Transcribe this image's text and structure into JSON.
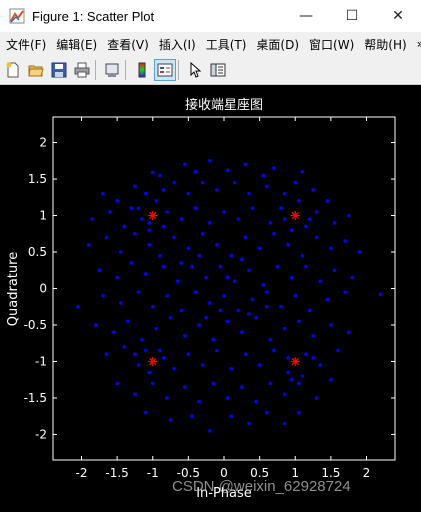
{
  "window": {
    "title": "Figure 1: Scatter Plot",
    "minimize_glyph": "—",
    "maximize_glyph": "☐",
    "close_glyph": "✕"
  },
  "menu": [
    "文件(F)",
    "编辑(E)",
    "查看(V)",
    "插入(I)",
    "工具(T)",
    "桌面(D)",
    "窗口(W)",
    "帮助(H)"
  ],
  "menu_overflow_glyph": "»",
  "toolbar": {
    "icons": [
      "new-figure-icon",
      "open-file-icon",
      "save-icon",
      "print-icon",
      "link-icon",
      "colorbar-icon",
      "legend-icon",
      "pointer-icon",
      "property-editor-icon"
    ]
  },
  "colors": {
    "received_points": "#0000ff",
    "constellation_points": "#ff0000",
    "axes_bg": "#000000",
    "axes_fg": "#ffffff"
  },
  "chart_data": {
    "type": "scatter",
    "title": "接收端星座图",
    "xlabel": "In-Phase",
    "ylabel": "Quadrature",
    "xlim": [
      -2.4,
      2.4
    ],
    "ylim": [
      -2.35,
      2.35
    ],
    "x_ticks": [
      -2,
      -1.5,
      -1,
      -0.5,
      0,
      0.5,
      1,
      1.5,
      2
    ],
    "y_ticks": [
      -2,
      -1.5,
      -1,
      -0.5,
      0,
      0.5,
      1,
      1.5,
      2
    ],
    "x_tick_labels": [
      "-2",
      "-1.5",
      "-1",
      "-0.5",
      "0",
      "0.5",
      "1",
      "1.5",
      "2"
    ],
    "y_tick_labels": [
      "-2",
      "-1.5",
      "-1",
      "-0.5",
      "0",
      "0.5",
      "1",
      "1.5",
      "2"
    ],
    "grid": false,
    "series": [
      {
        "marker": "dot",
        "color": "#0000ff",
        "points": [
          [
            -1.0,
            1.59
          ],
          [
            -0.9,
            1.55
          ],
          [
            -0.55,
            1.7
          ],
          [
            -0.4,
            1.6
          ],
          [
            -0.2,
            1.75
          ],
          [
            0.05,
            1.62
          ],
          [
            0.3,
            1.7
          ],
          [
            0.55,
            1.55
          ],
          [
            0.7,
            1.65
          ],
          [
            1.1,
            1.6
          ],
          [
            -1.7,
            1.3
          ],
          [
            -1.5,
            1.2
          ],
          [
            -1.25,
            1.4
          ],
          [
            -1.1,
            1.3
          ],
          [
            -0.85,
            1.35
          ],
          [
            -0.7,
            1.45
          ],
          [
            -0.5,
            1.3
          ],
          [
            -0.3,
            1.45
          ],
          [
            -0.1,
            1.35
          ],
          [
            0.15,
            1.45
          ],
          [
            0.35,
            1.3
          ],
          [
            0.6,
            1.4
          ],
          [
            0.85,
            1.3
          ],
          [
            1.0,
            1.45
          ],
          [
            1.25,
            1.35
          ],
          [
            1.45,
            1.2
          ],
          [
            -1.85,
            0.95
          ],
          [
            -1.6,
            1.05
          ],
          [
            -1.4,
            0.85
          ],
          [
            -1.2,
            1.1
          ],
          [
            -1.05,
            0.9
          ],
          [
            -0.8,
            1.05
          ],
          [
            -0.6,
            0.95
          ],
          [
            -0.4,
            1.1
          ],
          [
            -0.2,
            0.9
          ],
          [
            0.0,
            1.05
          ],
          [
            0.2,
            0.95
          ],
          [
            0.4,
            1.1
          ],
          [
            0.65,
            0.9
          ],
          [
            0.8,
            1.1
          ],
          [
            1.15,
            0.85
          ],
          [
            1.3,
            1.05
          ],
          [
            1.55,
            0.9
          ],
          [
            1.75,
            1.0
          ],
          [
            -1.9,
            0.6
          ],
          [
            -1.65,
            0.7
          ],
          [
            -1.45,
            0.5
          ],
          [
            -1.25,
            0.75
          ],
          [
            -1.05,
            0.6
          ],
          [
            -0.9,
            0.45
          ],
          [
            -0.7,
            0.7
          ],
          [
            -0.5,
            0.55
          ],
          [
            -0.3,
            0.75
          ],
          [
            -0.1,
            0.6
          ],
          [
            0.1,
            0.45
          ],
          [
            0.3,
            0.7
          ],
          [
            0.5,
            0.55
          ],
          [
            0.7,
            0.75
          ],
          [
            0.9,
            0.6
          ],
          [
            1.1,
            0.45
          ],
          [
            1.3,
            0.7
          ],
          [
            1.5,
            0.55
          ],
          [
            1.7,
            0.65
          ],
          [
            1.9,
            0.5
          ],
          [
            -1.75,
            0.25
          ],
          [
            -1.5,
            0.15
          ],
          [
            -1.3,
            0.35
          ],
          [
            -1.1,
            0.2
          ],
          [
            -0.85,
            0.3
          ],
          [
            -0.65,
            0.1
          ],
          [
            -0.45,
            0.3
          ],
          [
            -0.25,
            0.15
          ],
          [
            -0.05,
            0.3
          ],
          [
            0.15,
            0.1
          ],
          [
            0.35,
            0.25
          ],
          [
            0.55,
            0.05
          ],
          [
            0.75,
            0.3
          ],
          [
            0.95,
            0.15
          ],
          [
            1.15,
            0.3
          ],
          [
            1.35,
            0.1
          ],
          [
            1.55,
            0.25
          ],
          [
            1.8,
            0.15
          ],
          [
            -2.05,
            -0.25
          ],
          [
            -1.7,
            -0.1
          ],
          [
            -1.45,
            -0.2
          ],
          [
            -1.2,
            -0.05
          ],
          [
            -1.0,
            -0.25
          ],
          [
            -0.8,
            -0.1
          ],
          [
            -0.6,
            -0.3
          ],
          [
            -0.4,
            -0.05
          ],
          [
            -0.2,
            -0.2
          ],
          [
            0.0,
            -0.1
          ],
          [
            0.2,
            -0.3
          ],
          [
            0.4,
            -0.15
          ],
          [
            0.6,
            -0.05
          ],
          [
            0.8,
            -0.25
          ],
          [
            1.0,
            -0.1
          ],
          [
            1.2,
            -0.3
          ],
          [
            1.45,
            -0.15
          ],
          [
            1.7,
            -0.05
          ],
          [
            2.2,
            -0.08
          ],
          [
            -1.8,
            -0.5
          ],
          [
            -1.55,
            -0.6
          ],
          [
            -1.35,
            -0.45
          ],
          [
            -1.15,
            -0.7
          ],
          [
            -0.95,
            -0.55
          ],
          [
            -0.75,
            -0.4
          ],
          [
            -0.55,
            -0.65
          ],
          [
            -0.35,
            -0.5
          ],
          [
            -0.15,
            -0.7
          ],
          [
            0.05,
            -0.45
          ],
          [
            0.25,
            -0.6
          ],
          [
            0.45,
            -0.4
          ],
          [
            0.65,
            -0.7
          ],
          [
            0.85,
            -0.55
          ],
          [
            1.05,
            -0.45
          ],
          [
            1.25,
            -0.65
          ],
          [
            1.5,
            -0.5
          ],
          [
            1.75,
            -0.6
          ],
          [
            -1.65,
            -0.9
          ],
          [
            -1.4,
            -0.8
          ],
          [
            -1.2,
            -1.05
          ],
          [
            -0.9,
            -0.85
          ],
          [
            -0.7,
            -1.1
          ],
          [
            -0.5,
            -0.9
          ],
          [
            -0.3,
            -1.05
          ],
          [
            -0.1,
            -0.85
          ],
          [
            0.1,
            -1.1
          ],
          [
            0.3,
            -0.9
          ],
          [
            0.5,
            -1.05
          ],
          [
            0.7,
            -0.85
          ],
          [
            0.9,
            -1.15
          ],
          [
            1.15,
            -0.9
          ],
          [
            1.35,
            -1.05
          ],
          [
            1.6,
            -0.85
          ],
          [
            -1.5,
            -1.3
          ],
          [
            -1.25,
            -1.45
          ],
          [
            -1.0,
            -1.3
          ],
          [
            -0.8,
            -1.5
          ],
          [
            -0.55,
            -1.35
          ],
          [
            -0.35,
            -1.55
          ],
          [
            -0.15,
            -1.3
          ],
          [
            0.05,
            -1.5
          ],
          [
            0.25,
            -1.35
          ],
          [
            0.45,
            -1.55
          ],
          [
            0.65,
            -1.3
          ],
          [
            0.85,
            -1.45
          ],
          [
            1.05,
            -1.3
          ],
          [
            1.3,
            -1.5
          ],
          [
            1.5,
            -1.25
          ],
          [
            -1.1,
            -1.7
          ],
          [
            -0.75,
            -1.8
          ],
          [
            -0.45,
            -1.75
          ],
          [
            -0.2,
            -1.95
          ],
          [
            0.1,
            -1.75
          ],
          [
            0.35,
            -1.85
          ],
          [
            0.6,
            -1.7
          ],
          [
            0.85,
            -1.85
          ],
          [
            1.05,
            -1.7
          ],
          [
            -1.3,
            1.1
          ],
          [
            -1.15,
            0.95
          ],
          [
            -0.95,
            1.2
          ],
          [
            -1.05,
            0.8
          ],
          [
            -0.85,
            0.85
          ],
          [
            0.85,
            0.95
          ],
          [
            1.05,
            1.2
          ],
          [
            1.2,
            0.95
          ],
          [
            0.95,
            0.8
          ],
          [
            -1.25,
            -0.9
          ],
          [
            -1.05,
            -1.15
          ],
          [
            -0.85,
            -0.95
          ],
          [
            -1.1,
            -0.85
          ],
          [
            0.9,
            -0.95
          ],
          [
            1.1,
            -1.2
          ],
          [
            1.25,
            -0.95
          ],
          [
            0.95,
            -1.25
          ],
          [
            -0.6,
            0.35
          ],
          [
            -0.35,
            0.45
          ],
          [
            0.35,
            -0.35
          ],
          [
            0.6,
            -0.25
          ],
          [
            0.25,
            0.4
          ],
          [
            -0.25,
            -0.4
          ],
          [
            0.05,
            0.15
          ],
          [
            -0.05,
            -0.3
          ]
        ]
      },
      {
        "marker": "star",
        "color": "#ff0000",
        "points": [
          [
            -1,
            1
          ],
          [
            1,
            1
          ],
          [
            -1,
            -1
          ],
          [
            1,
            -1
          ]
        ]
      }
    ]
  },
  "watermark": "CSDN @weixin_62928724"
}
